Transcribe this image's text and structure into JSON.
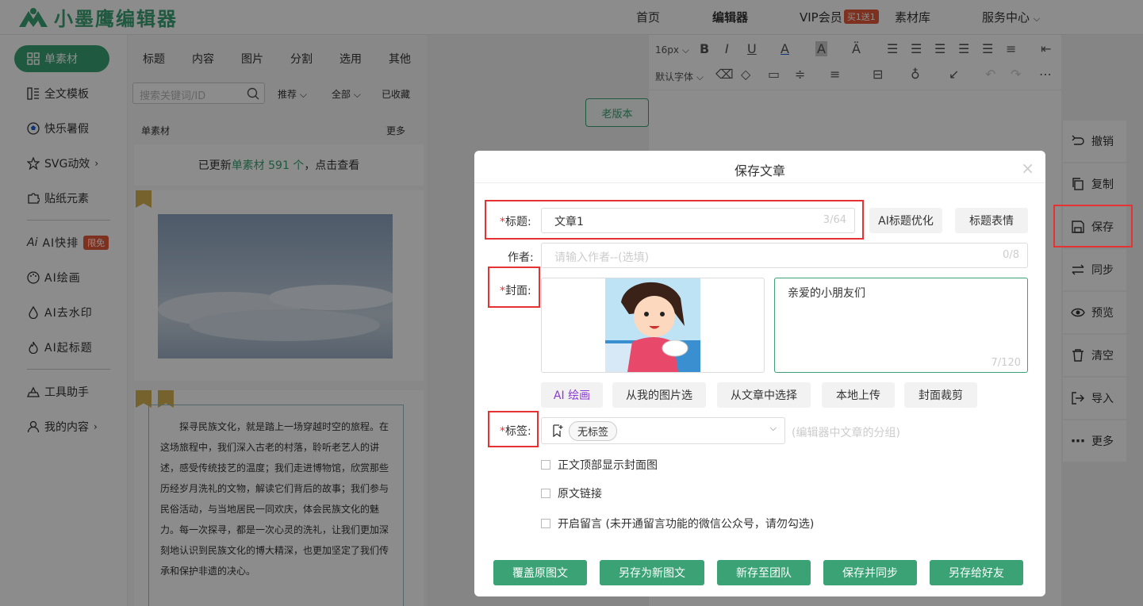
{
  "topbar": {
    "logo": "小墨鹰编辑器",
    "nav": [
      "首页",
      "编辑器",
      "VIP会员",
      "素材库",
      "服务中心"
    ],
    "vip_badge": "买1送1"
  },
  "sidebar": {
    "active": "单素材",
    "items": [
      "全文模板",
      "快乐暑假",
      "SVG动效",
      "贴纸元素",
      "AI快排",
      "AI绘画",
      "AI去水印",
      "AI起标题",
      "工具助手",
      "我的内容"
    ],
    "free_badge": "限免"
  },
  "panel": {
    "tabs": [
      "标题",
      "内容",
      "图片",
      "分割",
      "选用",
      "其他"
    ],
    "search_placeholder": "搜索关键词/ID",
    "filters": [
      "推荐",
      "全部",
      "已收藏"
    ],
    "list_title": "单素材",
    "list_more": "更多",
    "update_prefix": "已更新",
    "update_highlight": "单素材 591 个",
    "update_suffix": "，点击查看",
    "article_text": "探寻民族文化，就是踏上一场穿越时空的旅程。在这场旅程中，我们深入古老的村落，聆听老艺人的讲述，感受传统技艺的温度；我们走进博物馆，欣赏那些历经岁月洗礼的文物，解读它们背后的故事；我们参与民俗活动，与当地居民一同欢庆，体会民族文化的魅力。每一次探寻，都是一次心灵的洗礼，让我们更加深刻地认识到民族文化的博大精深，也更加坚定了我们传承和保护非遗的决心。"
  },
  "editor": {
    "font_size": "16px",
    "font_family": "默认字体",
    "old_version": "老版本"
  },
  "right_actions": [
    "撤销",
    "复制",
    "保存",
    "同步",
    "预览",
    "清空",
    "导入",
    "更多"
  ],
  "dialog": {
    "title": "保存文章",
    "title_label": "标题:",
    "title_value": "文章1",
    "title_count": "3/64",
    "ai_title_btn": "AI标题优化",
    "title_emoji_btn": "标题表情",
    "author_label": "作者:",
    "author_placeholder": "请输入作者--(选填)",
    "author_count": "0/8",
    "cover_label": "封面:",
    "summary_value": "亲爱的小朋友们",
    "summary_count": "7/120",
    "cover_buttons": [
      "AI 绘画",
      "从我的图片选",
      "从文章中选择",
      "本地上传",
      "封面裁剪"
    ],
    "tag_label": "标签:",
    "tag_value": "无标签",
    "tag_hint": "(编辑器中文章的分组)",
    "options": [
      "正文顶部显示封面图",
      "原文链接",
      "开启留言 (未开通留言功能的微信公众号，请勿勾选)"
    ],
    "footer_buttons": [
      "覆盖原图文",
      "另存为新图文",
      "新存至团队",
      "保存并同步",
      "另存给好友"
    ]
  },
  "colors": {
    "brand": "#3aa274",
    "red": "#e53333",
    "ai": "#8a3ad0"
  }
}
